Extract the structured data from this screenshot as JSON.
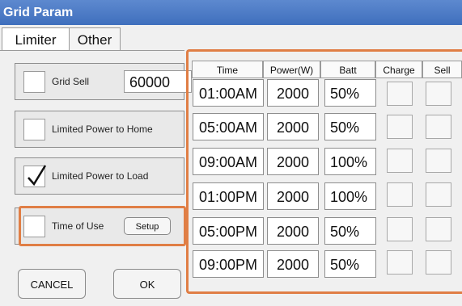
{
  "window": {
    "title": "Grid Param"
  },
  "tabs": [
    {
      "label": "Limiter"
    },
    {
      "label": "Other"
    }
  ],
  "options": {
    "grid_sell": {
      "label": "Grid Sell",
      "value": "60000",
      "checked": false
    },
    "limited_home": {
      "label": "Limited Power to Home",
      "checked": false
    },
    "limited_load": {
      "label": "Limited Power to Load",
      "checked": true
    },
    "time_of_use": {
      "label": "Time of Use",
      "checked": false,
      "setup_label": "Setup"
    }
  },
  "buttons": {
    "cancel": "CANCEL",
    "ok": "OK"
  },
  "schedule": {
    "headers": [
      "Time",
      "Power(W)",
      "Batt",
      "Charge",
      "Sell"
    ],
    "rows": [
      {
        "time": "01:00AM",
        "power": "2000",
        "batt": "50%",
        "charge": false,
        "sell": false
      },
      {
        "time": "05:00AM",
        "power": "2000",
        "batt": "50%",
        "charge": false,
        "sell": false
      },
      {
        "time": "09:00AM",
        "power": "2000",
        "batt": "100%",
        "charge": false,
        "sell": false
      },
      {
        "time": "01:00PM",
        "power": "2000",
        "batt": "100%",
        "charge": false,
        "sell": false
      },
      {
        "time": "05:00PM",
        "power": "2000",
        "batt": "50%",
        "charge": false,
        "sell": false
      },
      {
        "time": "09:00PM",
        "power": "2000",
        "batt": "50%",
        "charge": false,
        "sell": false
      }
    ]
  },
  "colors": {
    "titlebar": "#4a78c4",
    "highlight": "#e07e45"
  }
}
